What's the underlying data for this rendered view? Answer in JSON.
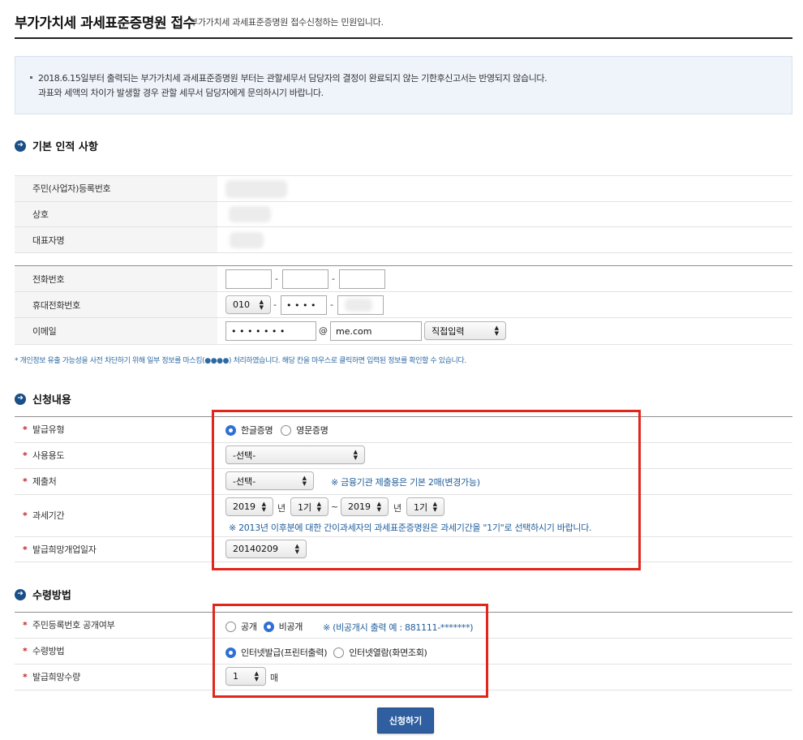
{
  "header": {
    "title": "부가가치세 과세표준증명원 접수",
    "subtitle": "부가가치세 과세표준증명원 접수신청하는 민원입니다."
  },
  "notice": {
    "line1": "2018.6.15일부터 출력되는 부가가치세 과세표준증명원 부터는 관할세무서 담당자의 결정이 완료되지 않는 기한후신고서는 반영되지 않습니다.",
    "line2": "과표와 세액의 차이가 발생할 경우 관할 세무서 담당자에게 문의하시기 바랍니다."
  },
  "basic": {
    "section_title": "기본 인적 사항",
    "rows": [
      {
        "label": "주민(사업자)등록번호"
      },
      {
        "label": "상호"
      },
      {
        "label": "대표자명"
      }
    ]
  },
  "contact": {
    "phone_label": "전화번호",
    "phone_sep": "-",
    "mobile_label": "휴대전화번호",
    "mobile_prefix": "010",
    "mobile_middle": "• • • •",
    "email_label": "이메일",
    "email_id": "• • • • • • •",
    "email_at": "@",
    "email_domain": "me.com",
    "email_select": "직접입력"
  },
  "mask_note": "* 개인정보 유출 가능성을 사전 차단하기 위해 일부 정보를 마스킹(●●●●) 처리하였습니다. 해당 칸을 마우스로 클릭하면 입력된 정보를 확인할 수 있습니다.",
  "apply": {
    "section_title": "신청내용",
    "required_mark": "*",
    "issue_type_label": "발급유형",
    "issue_type_korean": "한글증명",
    "issue_type_english": "영문증명",
    "usage_label": "사용용도",
    "usage_value": "-선택-",
    "submit_to_label": "제출처",
    "submit_to_value": "-선택-",
    "submit_to_note": "※ 금융기관 제출용은 기본 2매(변경가능)",
    "period_label": "과세기간",
    "period_from_year": "2019",
    "period_year_unit": "년",
    "period_from_term": "1기",
    "period_tilde": "~",
    "period_to_year": "2019",
    "period_to_term": "1기",
    "period_note": "※ 2013년 이후분에 대한 간이과세자의 과세표준증명원은 과세기간을 \"1기\"로 선택하시기 바랍니다.",
    "open_date_label": "발급희망개업일자",
    "open_date_value": "20140209"
  },
  "receive": {
    "section_title": "수령방법",
    "disclose_label": "주민등록번호 공개여부",
    "disclose_public": "공개",
    "disclose_private": "비공개",
    "disclose_note": "※ (비공개시 출력 예 : 881111-*******)",
    "method_label": "수령방법",
    "method_print": "인터넷발급(프린터출력)",
    "method_view": "인터넷열람(화면조회)",
    "count_label": "발급희망수량",
    "count_value": "1",
    "count_unit": "매"
  },
  "submit_label": "신청하기",
  "colors": {
    "accent": "#2f5fa0",
    "highlight_box": "#e1261c",
    "radio_on": "#2f6fd6",
    "note_blue": "#1f5d9b"
  }
}
